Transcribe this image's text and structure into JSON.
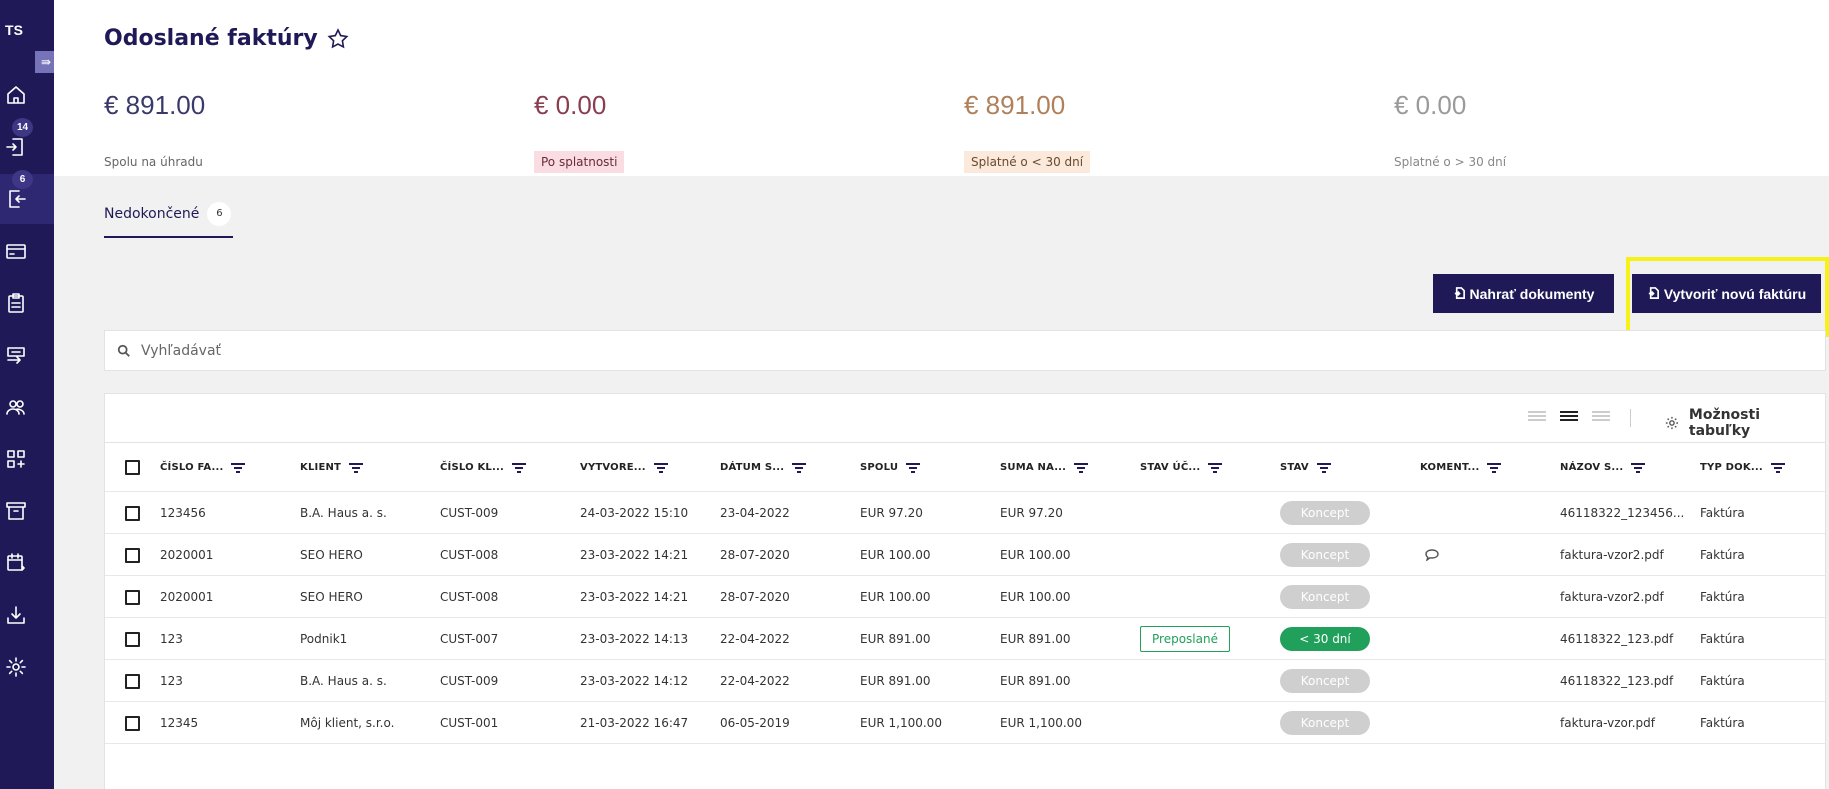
{
  "sidebar": {
    "logo": "TS",
    "toggle_icon": "collapse-arrow-icon",
    "items": [
      {
        "name": "home",
        "icon": "home-icon"
      },
      {
        "name": "incoming",
        "icon": "inbox-in-icon",
        "badge": "14"
      },
      {
        "name": "outgoing",
        "icon": "inbox-out-icon",
        "badge": "6",
        "active": true
      },
      {
        "name": "payments",
        "icon": "credit-card-icon"
      },
      {
        "name": "documents",
        "icon": "clipboard-icon"
      },
      {
        "name": "transfers",
        "icon": "transfer-icon"
      },
      {
        "name": "contacts",
        "icon": "users-icon"
      },
      {
        "name": "apps",
        "icon": "apps-add-icon"
      },
      {
        "name": "archive",
        "icon": "archive-icon"
      },
      {
        "name": "calendar",
        "icon": "calendar-icon"
      },
      {
        "name": "download",
        "icon": "download-icon"
      },
      {
        "name": "settings",
        "icon": "gear-icon"
      }
    ]
  },
  "header": {
    "title": "Odoslané faktúry",
    "summary": [
      {
        "amount": "€ 891.00",
        "label": "Spolu na úhradu",
        "amount_color": "#3a3a6a",
        "label_bg": "",
        "label_color": "#666666"
      },
      {
        "amount": "€ 0.00",
        "label": "Po splatnosti",
        "amount_color": "#8a3d4f",
        "label_bg": "#fadce3",
        "label_color": "#6a2a3a"
      },
      {
        "amount": "€ 891.00",
        "label": "Splatné o < 30 dní",
        "amount_color": "#b0805a",
        "label_bg": "#fbe9dc",
        "label_color": "#6a4a2a"
      },
      {
        "amount": "€ 0.00",
        "label": "Splatné o > 30 dní",
        "amount_color": "#9a9a9a",
        "label_bg": "",
        "label_color": "#888888"
      }
    ]
  },
  "tabs": [
    {
      "label": "Nedokončené",
      "count": "6"
    }
  ],
  "actions": {
    "upload_label": "Nahrať dokumenty",
    "create_label": "Vytvoriť novú faktúru"
  },
  "search": {
    "placeholder": "Vyhľadávať"
  },
  "table": {
    "options_label": "Možnosti tabuľky",
    "columns": [
      "ČÍSLO FA...",
      "KLIENT",
      "ČÍSLO KL...",
      "VYTVORE...",
      "DÁTUM S...",
      "SPOLU",
      "SUMA NA...",
      "STAV ÚČ...",
      "STAV",
      "KOMENT...",
      "NÁZOV S...",
      "TYP DOK..."
    ],
    "rows": [
      {
        "cislo": "123456",
        "klient": "B.A. Haus a. s.",
        "cislo_kl": "CUST-009",
        "vytvorene": "24-03-2022 15:10",
        "datum": "23-04-2022",
        "spolu": "EUR 97.20",
        "suma": "EUR 97.20",
        "stav_uc": "",
        "stav": "Koncept",
        "stav_type": "grey",
        "komentar": false,
        "nazov": "46118322_123456...",
        "typ": "Faktúra"
      },
      {
        "cislo": "2020001",
        "klient": "SEO HERO",
        "cislo_kl": "CUST-008",
        "vytvorene": "23-03-2022 14:21",
        "datum": "28-07-2020",
        "spolu": "EUR 100.00",
        "suma": "EUR 100.00",
        "stav_uc": "",
        "stav": "Koncept",
        "stav_type": "grey",
        "komentar": true,
        "nazov": "faktura-vzor2.pdf",
        "typ": "Faktúra"
      },
      {
        "cislo": "2020001",
        "klient": "SEO HERO",
        "cislo_kl": "CUST-008",
        "vytvorene": "23-03-2022 14:21",
        "datum": "28-07-2020",
        "spolu": "EUR 100.00",
        "suma": "EUR 100.00",
        "stav_uc": "",
        "stav": "Koncept",
        "stav_type": "grey",
        "komentar": false,
        "nazov": "faktura-vzor2.pdf",
        "typ": "Faktúra"
      },
      {
        "cislo": "123",
        "klient": "Podnik1",
        "cislo_kl": "CUST-007",
        "vytvorene": "23-03-2022 14:13",
        "datum": "22-04-2022",
        "spolu": "EUR 891.00",
        "suma": "EUR 891.00",
        "stav_uc": "Preposlané",
        "stav": "< 30 dní",
        "stav_type": "green",
        "komentar": false,
        "nazov": "46118322_123.pdf",
        "typ": "Faktúra"
      },
      {
        "cislo": "123",
        "klient": "B.A. Haus a. s.",
        "cislo_kl": "CUST-009",
        "vytvorene": "23-03-2022 14:12",
        "datum": "22-04-2022",
        "spolu": "EUR 891.00",
        "suma": "EUR 891.00",
        "stav_uc": "",
        "stav": "Koncept",
        "stav_type": "grey",
        "komentar": false,
        "nazov": "46118322_123.pdf",
        "typ": "Faktúra"
      },
      {
        "cislo": "12345",
        "klient": "Môj klient, s.r.o.",
        "cislo_kl": "CUST-001",
        "vytvorene": "21-03-2022 16:47",
        "datum": "06-05-2019",
        "spolu": "EUR 1,100.00",
        "suma": "EUR 1,100.00",
        "stav_uc": "",
        "stav": "Koncept",
        "stav_type": "grey",
        "komentar": false,
        "nazov": "faktura-vzor.pdf",
        "typ": "Faktúra"
      }
    ]
  }
}
